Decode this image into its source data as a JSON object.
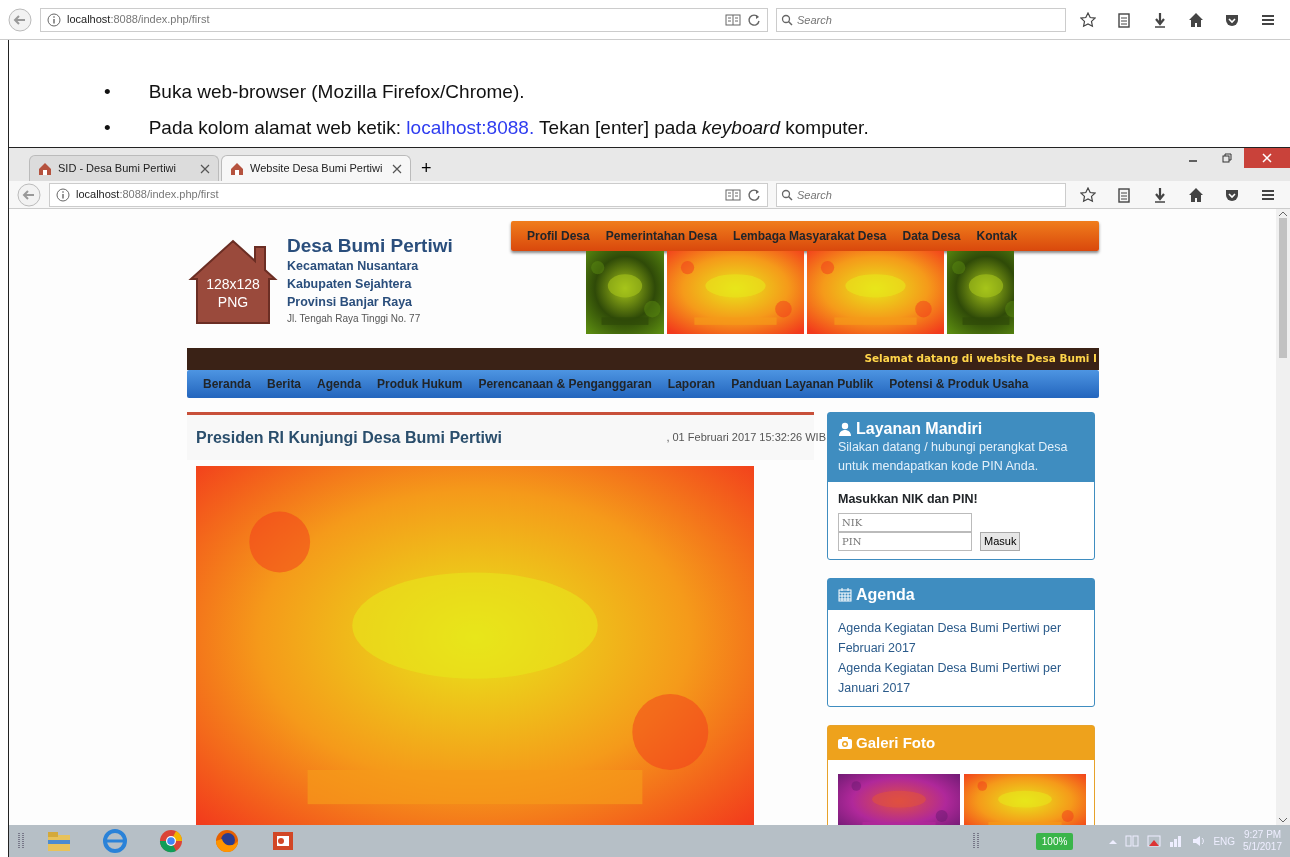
{
  "top_browser": {
    "url": "**localhost**:8088/index.php/first",
    "search_placeholder": "Search"
  },
  "document": {
    "bullets": [
      {
        "marker": "•",
        "parts": [
          {
            "kind": "text",
            "text": "Buka web-browser (Mozilla Firefox/Chrome)."
          }
        ]
      },
      {
        "marker": "•",
        "parts": [
          {
            "kind": "text",
            "text": "Pada kolom alamat web ketik: "
          },
          {
            "kind": "link",
            "text": "localhost:8088."
          },
          {
            "kind": "text",
            "text": " Tekan [enter] pada *keyboard* komputer."
          }
        ]
      }
    ]
  },
  "window": {
    "tabs": [
      {
        "title": "SID - Desa Bumi Pertiwi",
        "selected": false
      },
      {
        "title": "Website Desa Bumi Pertiwi",
        "selected": true
      }
    ],
    "new_tab": "+"
  },
  "browser": {
    "url": "**localhost**:8088/index.php/first",
    "search_placeholder": "Search"
  },
  "site": {
    "logo_lines": [
      "128x128",
      "PNG"
    ],
    "title": "Desa Bumi Pertiwi",
    "subtitles": [
      "Kecamatan Nusantara",
      "Kabupaten Sejahtera",
      "Provinsi Banjar Raya"
    ],
    "address": "Jl. Tengah Raya Tinggi No. 77",
    "top_menu": [
      "Profil Desa",
      "Pemerintahan Desa",
      "Lembaga Masyarakat Desa",
      "Data Desa",
      "Kontak"
    ],
    "slides": [
      {
        "kind": "picture"
      },
      {
        "kind": "picture"
      },
      {
        "kind": "picture"
      },
      {
        "kind": "picture"
      }
    ],
    "marquee": "Selamat datang di website Desa Bumi I",
    "main_menu": [
      "Beranda",
      "Berita",
      "Agenda",
      "Produk Hukum",
      "Perencanaan & Penganggaran",
      "Laporan",
      "Panduan Layanan Publik",
      "Potensi & Produk Usaha"
    ],
    "article": {
      "title": "Presiden RI Kunjungi Desa Bumi Pertiwi",
      "date": ", 01 Februari 2017 15:32:26 WIB",
      "image": {
        "kind": "picture"
      }
    },
    "sidebar": {
      "login": {
        "title": "Layanan Mandiri",
        "text": "Silakan datang / hubungi perangkat Desa untuk mendapatkan kode PIN Anda.",
        "form_title": "Masukkan NIK dan PIN!",
        "nik_placeholder": "NIK",
        "pin_placeholder": "PIN",
        "button": "Masuk"
      },
      "agenda": {
        "title": "Agenda",
        "items": [
          "Agenda Kegiatan Desa Bumi Pertiwi per Februari 2017",
          "Agenda Kegiatan Desa Bumi Pertiwi per Januari 2017"
        ]
      },
      "gallery": {
        "title": "Galeri Foto",
        "photos": [
          {
            "kind": "picture"
          },
          {
            "kind": "picture"
          }
        ]
      }
    }
  },
  "taskbar": {
    "battery": "100%",
    "language": "ENG",
    "time": "9:27 PM",
    "date": "5/1/2017"
  }
}
